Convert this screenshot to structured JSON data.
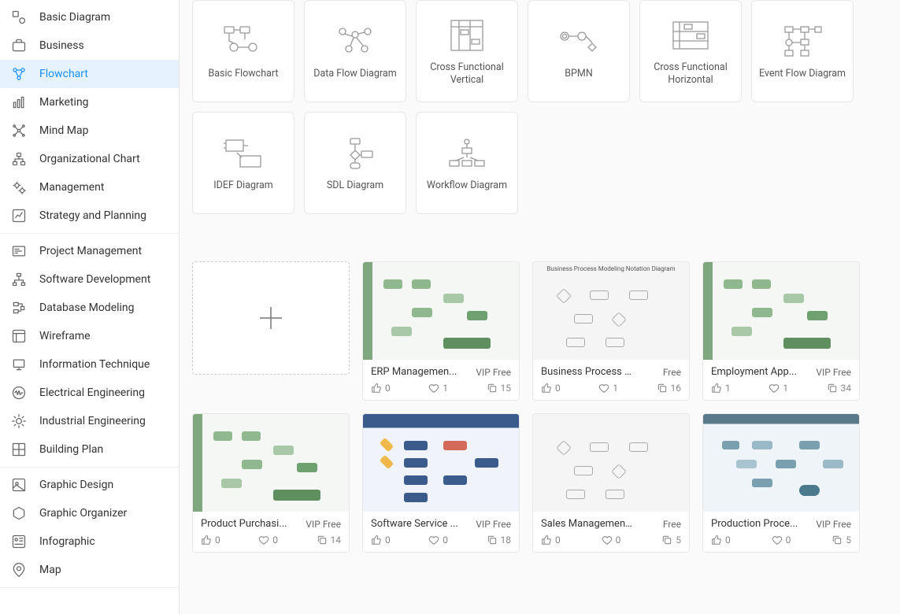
{
  "sidebar": {
    "group1": [
      {
        "label": "Basic Diagram",
        "icon": "basic-diagram-icon"
      },
      {
        "label": "Business",
        "icon": "briefcase-icon"
      },
      {
        "label": "Flowchart",
        "icon": "flowchart-icon",
        "active": true
      },
      {
        "label": "Marketing",
        "icon": "chart-bars-icon"
      },
      {
        "label": "Mind Map",
        "icon": "mindmap-icon"
      },
      {
        "label": "Organizational Chart",
        "icon": "org-chart-icon"
      },
      {
        "label": "Management",
        "icon": "gears-icon"
      },
      {
        "label": "Strategy and Planning",
        "icon": "trend-icon"
      }
    ],
    "group2": [
      {
        "label": "Project Management",
        "icon": "gantt-icon"
      },
      {
        "label": "Software Development",
        "icon": "tree-icon"
      },
      {
        "label": "Database Modeling",
        "icon": "database-icon"
      },
      {
        "label": "Wireframe",
        "icon": "wireframe-icon"
      },
      {
        "label": "Information Technique",
        "icon": "info-tech-icon"
      },
      {
        "label": "Electrical Engineering",
        "icon": "circuit-icon"
      },
      {
        "label": "Industrial Engineering",
        "icon": "industrial-icon"
      },
      {
        "label": "Building Plan",
        "icon": "building-icon"
      }
    ],
    "group3": [
      {
        "label": "Graphic Design",
        "icon": "design-icon"
      },
      {
        "label": "Graphic Organizer",
        "icon": "hex-icon"
      },
      {
        "label": "Infographic",
        "icon": "infographic-icon"
      },
      {
        "label": "Map",
        "icon": "map-pin-icon"
      }
    ]
  },
  "diagram_types": [
    {
      "label": "Basic Flowchart"
    },
    {
      "label": "Data Flow Diagram"
    },
    {
      "label": "Cross Functional Vertical"
    },
    {
      "label": "BPMN"
    },
    {
      "label": "Cross Functional Horizontal"
    },
    {
      "label": "Event Flow Diagram"
    },
    {
      "label": "IDEF Diagram"
    },
    {
      "label": "SDL Diagram"
    },
    {
      "label": "Workflow Diagram"
    }
  ],
  "templates": [
    {
      "title": "ERP Managemen...",
      "badge": "VIP Free",
      "likes": "0",
      "hearts": "1",
      "copies": "15",
      "thumb": "green"
    },
    {
      "title": "Business Process Mo...",
      "badge": "Free",
      "likes": "0",
      "hearts": "1",
      "copies": "16",
      "thumb": "gray"
    },
    {
      "title": "Employment App...",
      "badge": "VIP Free",
      "likes": "1",
      "hearts": "1",
      "copies": "34",
      "thumb": "green"
    },
    {
      "title": "Product Purchasi...",
      "badge": "VIP Free",
      "likes": "0",
      "hearts": "0",
      "copies": "14",
      "thumb": "green"
    },
    {
      "title": "Software Service ...",
      "badge": "VIP Free",
      "likes": "0",
      "hearts": "0",
      "copies": "18",
      "thumb": "blue"
    },
    {
      "title": "Sales Management C...",
      "badge": "Free",
      "likes": "0",
      "hearts": "0",
      "copies": "5",
      "thumb": "gray"
    },
    {
      "title": "Production Proce...",
      "badge": "VIP Free",
      "likes": "0",
      "hearts": "0",
      "copies": "5",
      "thumb": "dark"
    }
  ],
  "template_header": "Business Process Modeling Notation Diagram"
}
